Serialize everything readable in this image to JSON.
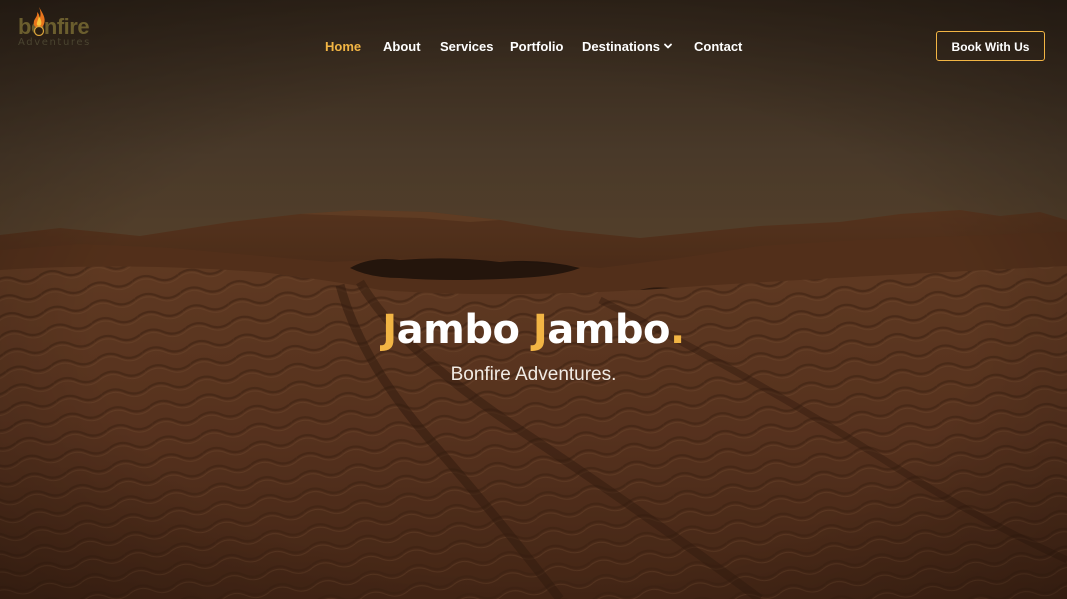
{
  "logo": {
    "word": "bonfire",
    "sub": "Adventures"
  },
  "nav": {
    "items": [
      {
        "label": "Home",
        "active": true
      },
      {
        "label": "About"
      },
      {
        "label": "Services"
      },
      {
        "label": "Portfolio"
      },
      {
        "label": "Destinations",
        "has_dropdown": true
      },
      {
        "label": "Contact"
      }
    ],
    "cta": "Book With Us"
  },
  "hero": {
    "title_part1_accent": "J",
    "title_part1_rest": "ambo ",
    "title_part2_accent": "J",
    "title_part2_rest": "ambo",
    "title_dot": ".",
    "subtitle": "Bonfire Adventures."
  },
  "colors": {
    "accent": "#f2b544",
    "text": "#ffffff",
    "sky": "#5b4a36",
    "sand": "#7a4a2a"
  },
  "icons": {
    "dropdown": "chevron-down-icon",
    "logo_flame": "flame-icon"
  }
}
